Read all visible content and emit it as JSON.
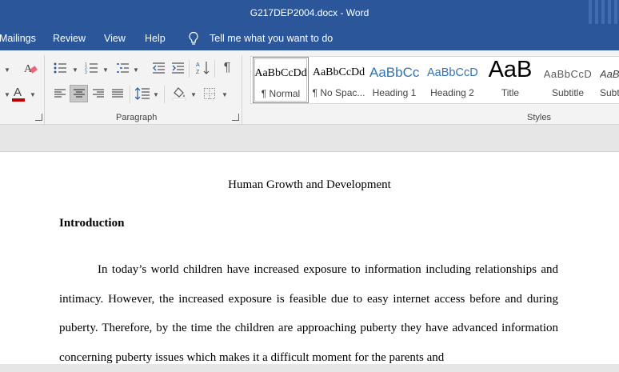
{
  "window": {
    "title": "G217DEP2004.docx  -  Word"
  },
  "menu": {
    "tabs": [
      "Mailings",
      "Review",
      "View",
      "Help"
    ],
    "tell_me": "Tell me what you want to do"
  },
  "ribbon": {
    "paragraph_group_label": "Paragraph",
    "styles_group_label": "Styles",
    "styles": [
      {
        "sample": "AaBbCcDd",
        "name": "¶ Normal"
      },
      {
        "sample": "AaBbCcDd",
        "name": "¶ No Spac..."
      },
      {
        "sample": "AaBbCc",
        "name": "Heading 1"
      },
      {
        "sample": "AaBbCcD",
        "name": "Heading 2"
      },
      {
        "sample": "AaB",
        "name": "Title"
      },
      {
        "sample": "AaBbCcD",
        "name": "Subtitle"
      },
      {
        "sample": "AaBbCcDd",
        "name": "Subtle Em..."
      }
    ],
    "font_color": "#c00000",
    "accent_color": "#2b579a"
  },
  "document": {
    "title": "Human Growth and Development",
    "heading": "Introduction",
    "paragraph": "In today’s world children have increased exposure to information including relationships and intimacy. However, the increased exposure is feasible due to easy internet access before and during puberty. Therefore, by the time the children are approaching puberty they have advanced information concerning puberty issues which makes it a difficult moment for the parents and"
  }
}
